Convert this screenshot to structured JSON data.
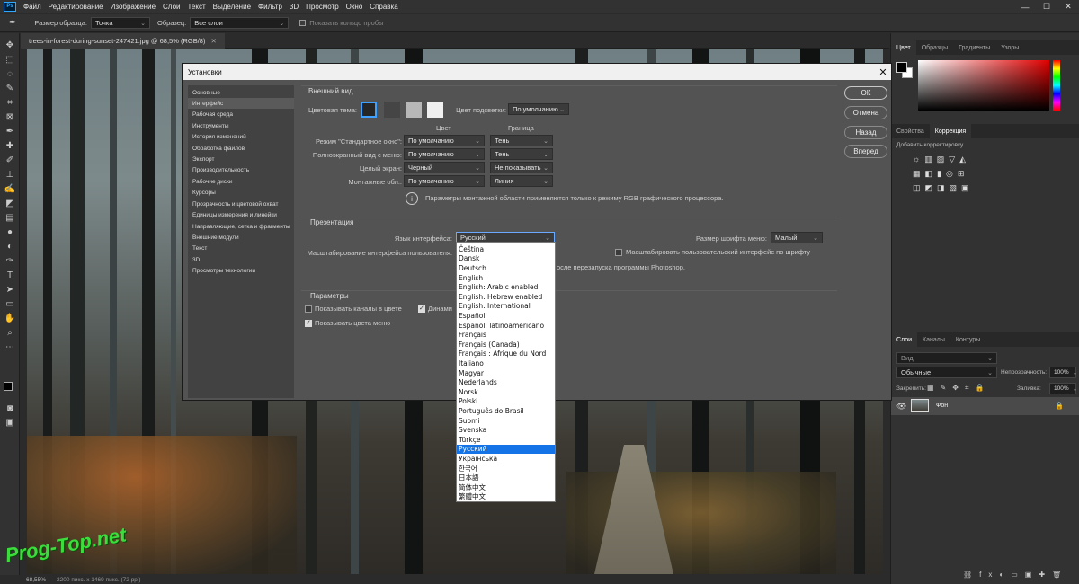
{
  "menubar": {
    "items": [
      "Файл",
      "Редактирование",
      "Изображение",
      "Слои",
      "Текст",
      "Выделение",
      "Фильтр",
      "3D",
      "Просмотр",
      "Окно",
      "Справка"
    ]
  },
  "options": {
    "sample_size_label": "Размер образца:",
    "sample_size_value": "Точка",
    "sample_label": "Образец:",
    "sample_value": "Все слои",
    "ring_label": "Показать кольцо пробы"
  },
  "document": {
    "tab_title": "trees-in-forest-during-sunset-247421.jpg @ 68,5% (RGB/8)",
    "zoom": "68,55%",
    "doc_info": "2200 пикс. x 1469 пикс. (72 ppi)"
  },
  "panels": {
    "color_tabs": [
      "Цвет",
      "Образцы",
      "Градиенты",
      "Узоры"
    ],
    "adjust_tabs": [
      "Свойства",
      "Коррекция"
    ],
    "adjust_hint": "Добавить корректировку",
    "layers_tabs": [
      "Слои",
      "Каналы",
      "Контуры"
    ],
    "layers_search": "Вид",
    "blend_mode": "Обычные",
    "opacity_label": "Непрозрачность:",
    "opacity_value": "100%",
    "lock_label": "Закрепить:",
    "fill_label": "Заливка:",
    "fill_value": "100%",
    "layer_name": "Фон"
  },
  "dialog": {
    "title": "Установки",
    "nav": [
      "Основные",
      "Интерфейс",
      "Рабочая среда",
      "Инструменты",
      "История изменений",
      "Обработка файлов",
      "Экспорт",
      "Производительность",
      "Рабочие диски",
      "Курсоры",
      "Прозрачность и цветовой охват",
      "Единицы измерения и линейки",
      "Направляющие, сетка и фрагменты",
      "Внешние модули",
      "Текст",
      "3D",
      "Просмотры технологии"
    ],
    "appearance": {
      "title": "Внешний вид",
      "theme_label": "Цветовая тема:",
      "highlight_label": "Цвет подсветки:",
      "highlight_value": "По умолчанию",
      "col_color": "Цвет",
      "col_border": "Граница",
      "rows": [
        {
          "label": "Режим \"Стандартное окно\":",
          "color": "По умолчанию",
          "border": "Тень"
        },
        {
          "label": "Полноэкранный вид с меню:",
          "color": "По умолчанию",
          "border": "Тень"
        },
        {
          "label": "Целый экран:",
          "color": "Черный",
          "border": "Не показывать"
        },
        {
          "label": "Монтажные обл.:",
          "color": "По умолчанию",
          "border": "Линия"
        }
      ],
      "info": "Параметры монтажной области применяются только к режиму RGB графического процессора."
    },
    "presentation": {
      "title": "Презентация",
      "lang_label": "Язык интерфейса:",
      "lang_value": "Русский",
      "font_size_label": "Размер шрифта меню:",
      "font_size_value": "Малый",
      "scale_label": "Масштабирование интерфейса пользователя:",
      "scale_font_label": "Масштабировать пользовательский интерфейс по шрифту",
      "restart_note": "осле перезапуска программы Photoshop."
    },
    "params": {
      "title": "Параметры",
      "show_channels": "Показывать каналы в цвете",
      "dynamic": "Динами",
      "show_menu_colors": "Показывать цвета меню"
    },
    "buttons": {
      "ok": "ОК",
      "cancel": "Отмена",
      "back": "Назад",
      "forward": "Вперед"
    },
    "languages": [
      "Čeština",
      "Dansk",
      "Deutsch",
      "English",
      "English: Arabic enabled",
      "English: Hebrew enabled",
      "English: International",
      "Español",
      "Español: latinoamericano",
      "Français",
      "Français (Canada)",
      "Français : Afrique du Nord",
      "Italiano",
      "Magyar",
      "Nederlands",
      "Norsk",
      "Polski",
      "Português do Brasil",
      "Suomi",
      "Svenska",
      "Türkçe",
      "Русский",
      "Українська",
      "한국어",
      "日本語",
      "简体中文",
      "繁體中文"
    ],
    "selected_language_index": 21
  },
  "watermark": "Prog-Top.net"
}
